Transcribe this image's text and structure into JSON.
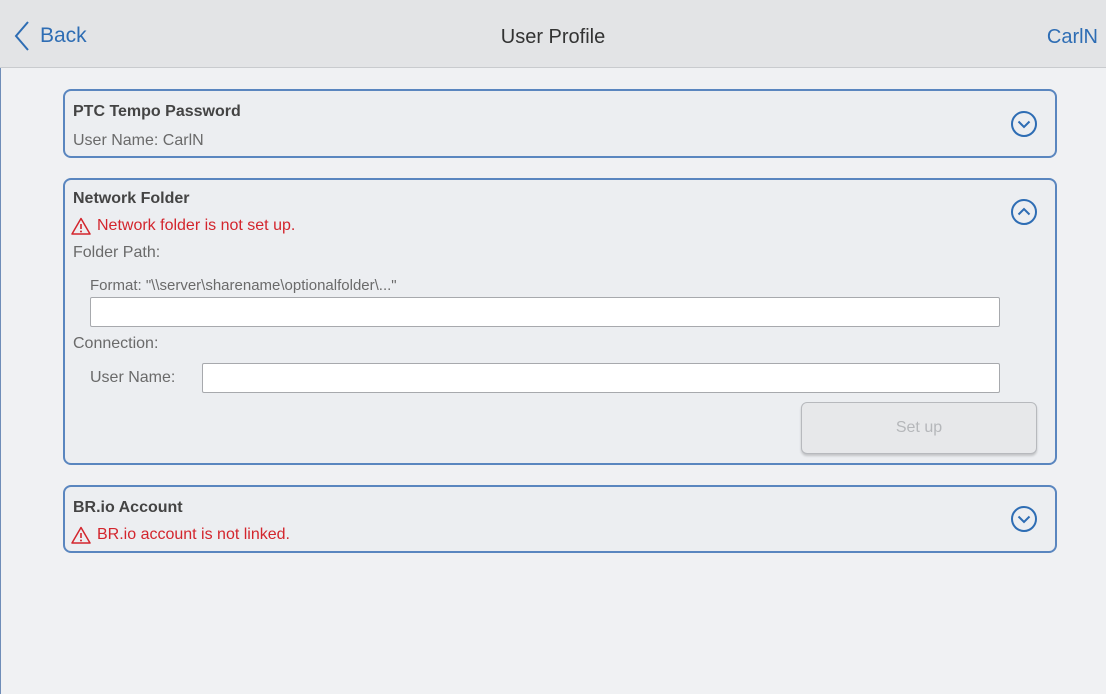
{
  "header": {
    "back_label": "Back",
    "title": "User Profile",
    "user": "CarlN"
  },
  "ptc_card": {
    "title": "PTC Tempo Password",
    "subtitle": "User Name: CarlN",
    "expanded": false
  },
  "network_card": {
    "title": "Network Folder",
    "warning": "Network folder is not set up.",
    "folder_path_label": "Folder Path:",
    "format_hint": "Format: \"\\\\server\\sharename\\optionalfolder\\...\"",
    "folder_path_value": "",
    "connection_label": "Connection:",
    "username_label": "User Name:",
    "username_value": "",
    "setup_button": "Set up",
    "expanded": true
  },
  "brio_card": {
    "title": "BR.io Account",
    "warning": "BR.io account is not linked.",
    "expanded": false
  },
  "colors": {
    "accent": "#2e6db4",
    "card_border": "#5a86bf",
    "warning": "#d3252d",
    "background": "#f0f1f3"
  }
}
